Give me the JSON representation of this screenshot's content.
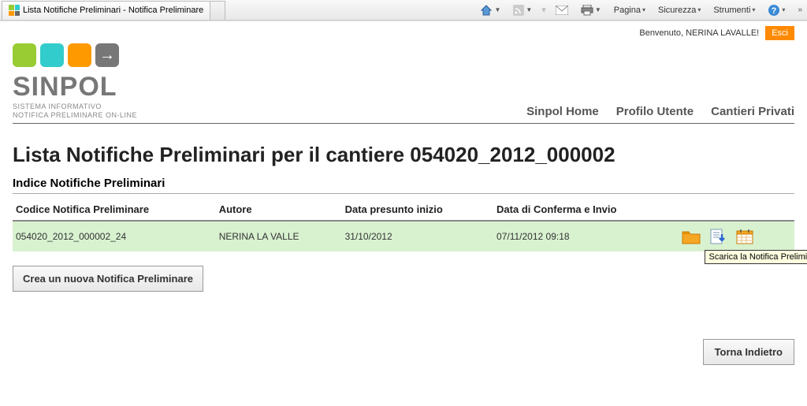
{
  "browser": {
    "tab_title": "Lista Notifiche Preliminari - Notifica Preliminare",
    "toolbar": {
      "pagina": "Pagina",
      "sicurezza": "Sicurezza",
      "strumenti": "Strumenti"
    }
  },
  "header": {
    "welcome": "Benvenuto, NERINA LAVALLE!",
    "logout": "Esci"
  },
  "logo": {
    "text": "SINPOL",
    "sub1": "SISTEMA INFORMATIVO",
    "sub2": "NOTIFICA PRELIMINARE ON-LINE"
  },
  "nav": {
    "home": "Sinpol Home",
    "profilo": "Profilo Utente",
    "cantieri": "Cantieri Privati"
  },
  "main": {
    "title": "Lista Notifiche Preliminari per il cantiere 054020_2012_000002",
    "section": "Indice Notifiche Preliminari",
    "columns": {
      "codice": "Codice Notifica Preliminare",
      "autore": "Autore",
      "data_inizio": "Data presunto inizio",
      "data_conferma": "Data di Conferma e Invio"
    },
    "rows": [
      {
        "codice": "054020_2012_000002_24",
        "autore": "NERINA LA VALLE",
        "data_inizio": "31/10/2012",
        "data_conferma": "07/11/2012 09:18"
      }
    ],
    "tooltip": "Scarica la Notifica Preliminare",
    "create": "Crea un nuova Notifica Preliminare",
    "back": "Torna Indietro"
  }
}
